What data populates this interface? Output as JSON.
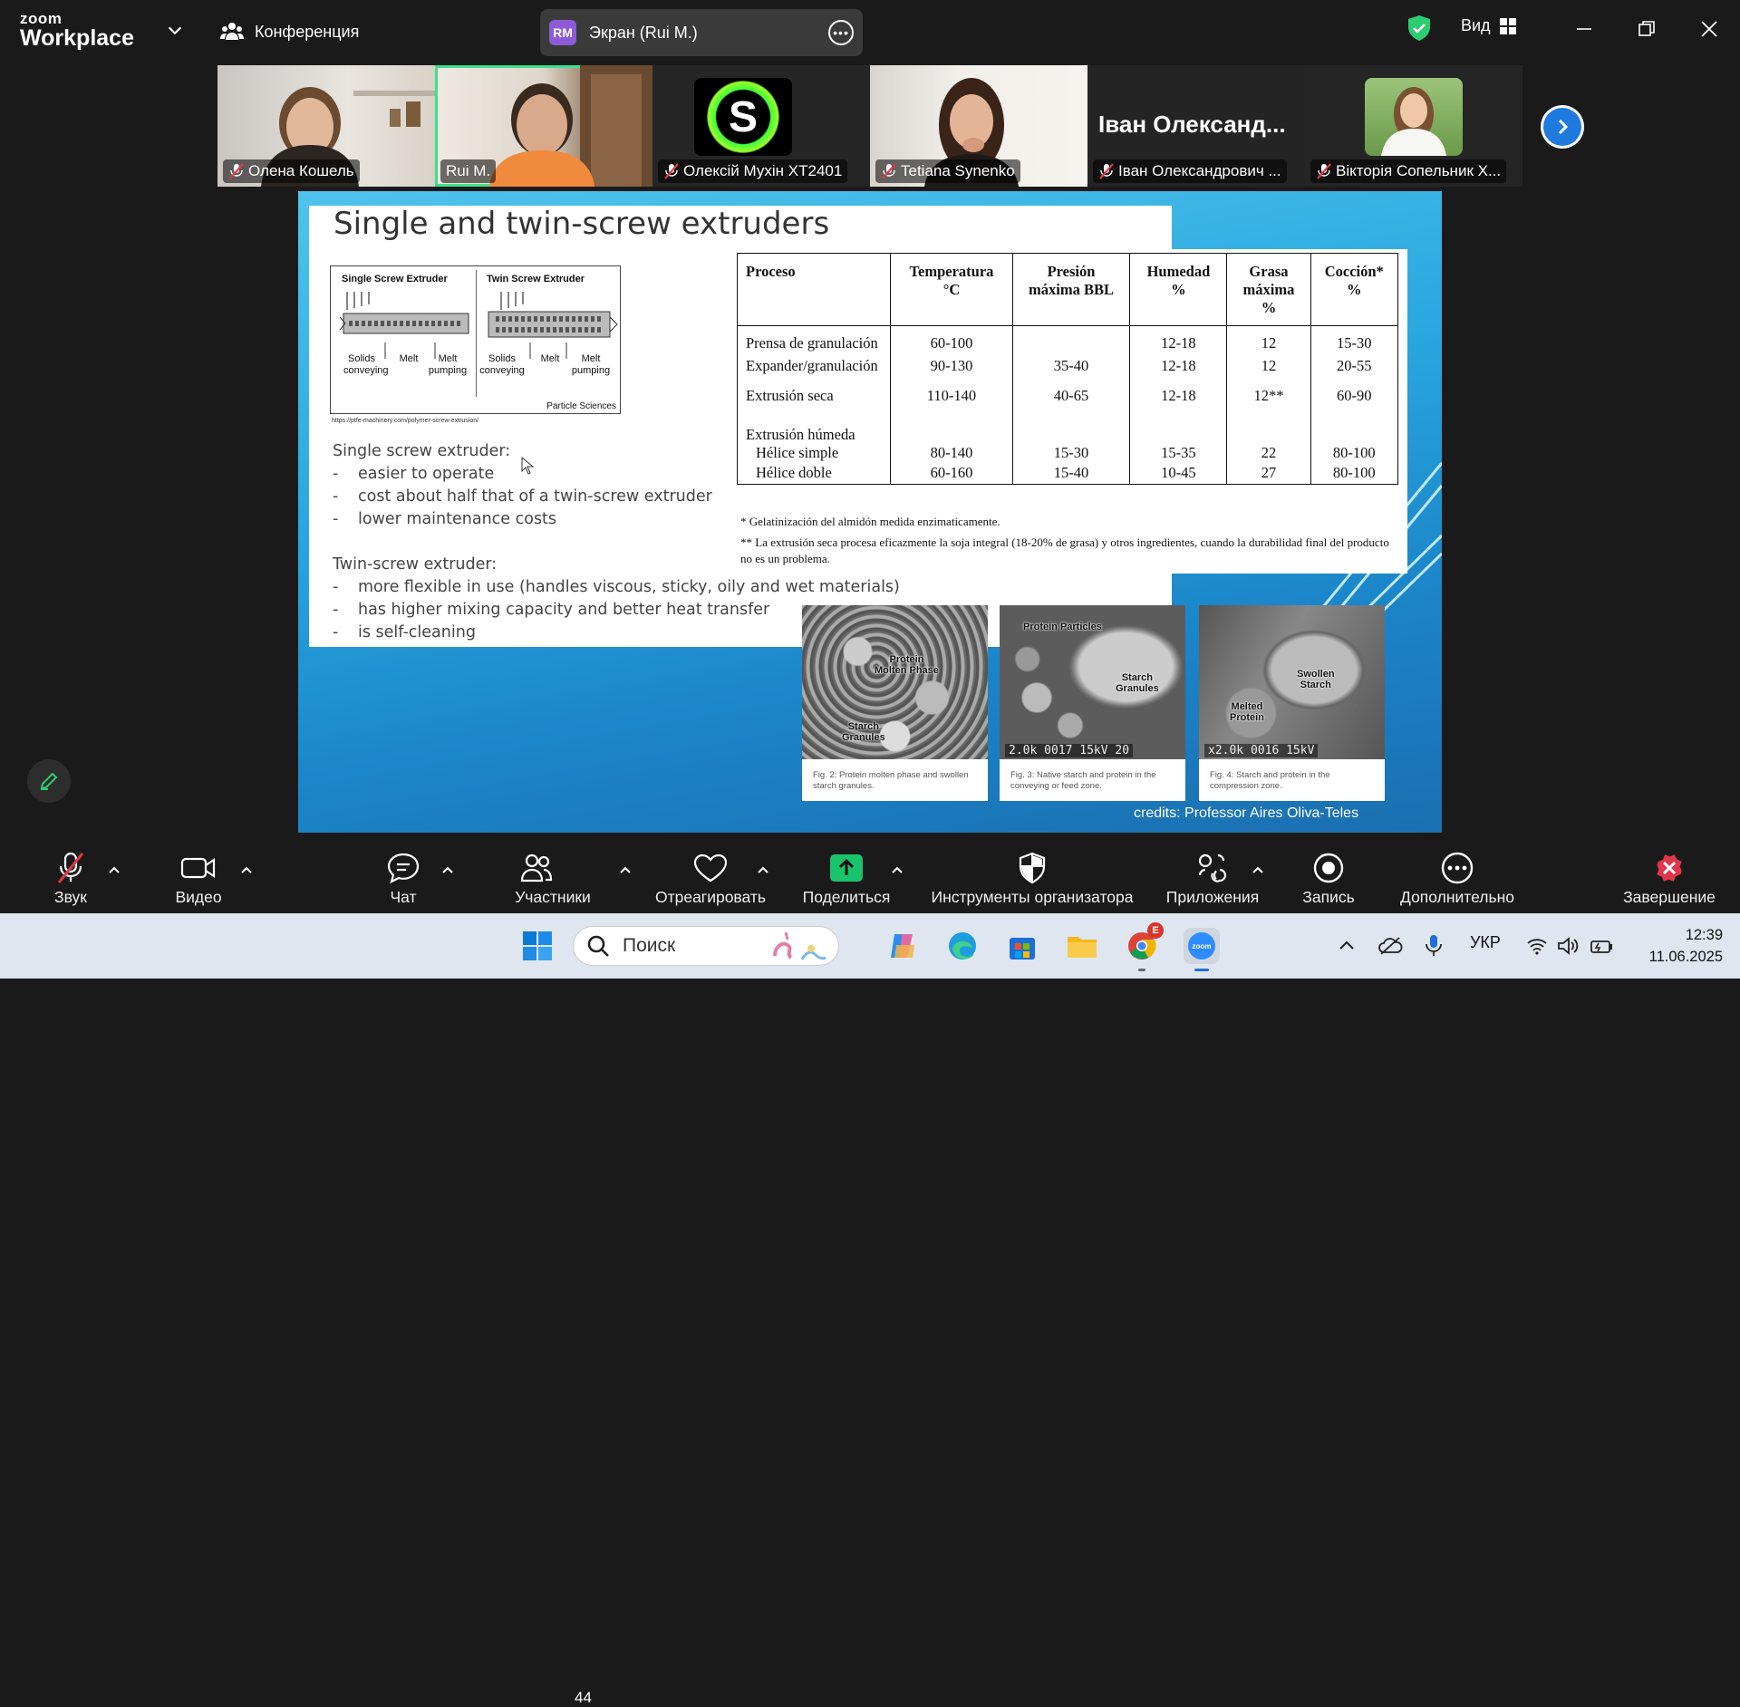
{
  "app": {
    "logo_top": "zoom",
    "logo_bottom": "Workplace"
  },
  "header": {
    "meeting_title": "Конференция",
    "screen_share": {
      "badge": "RM",
      "label": "Экран (Rui M.)"
    },
    "view_label": "Вид",
    "shield_color": "#2ecc71"
  },
  "participants": [
    {
      "name": "Олена Кошель",
      "muted": true
    },
    {
      "name": "Rui M.",
      "muted": false,
      "active": true
    },
    {
      "name": "Олексій Мухін ХТ2401",
      "muted": true,
      "avatar_letter": "S"
    },
    {
      "name": "Tetiana Synenko",
      "muted": true
    },
    {
      "name": "Іван Олександрович ...",
      "muted": true,
      "display_text": "Іван  Олександ..."
    },
    {
      "name": "Вікторія Сопельник Х...",
      "muted": true
    }
  ],
  "slide": {
    "title": "Single and twin-screw extruders",
    "extruder_figure": {
      "single_title": "Single Screw Extruder",
      "twin_title": "Twin Screw Extruder",
      "single_labels": [
        "Solids\nconveying",
        "Melt",
        "Melt\npumping"
      ],
      "twin_labels": [
        "Solids\nconveying",
        "Melt",
        "Melt\npumping"
      ],
      "footer": "Particle Sciences",
      "url": "https://ptfe-machinery.com/polymer-screw-extrusion/"
    },
    "single_heading": "Single screw extruder:",
    "single_points": [
      "easier to operate",
      "cost about half that of a twin-screw extruder",
      "lower maintenance costs"
    ],
    "twin_heading": "Twin-screw extruder:",
    "twin_points": [
      "more flexible in use (handles viscous, sticky, oily and wet materials)",
      "has higher mixing capacity and better heat transfer",
      "is self-cleaning"
    ],
    "table": {
      "headers": [
        "Proceso",
        "Temperatura\n°C",
        "Presión\nmáxima BBL",
        "Humedad\n%",
        "Grasa\nmáxima\n%",
        "Cocción*\n%"
      ],
      "rows": [
        [
          "Prensa de granulación",
          "60-100",
          "",
          "12-18",
          "12",
          "15-30"
        ],
        [
          "Expander/granulación",
          "90-130",
          "35-40",
          "12-18",
          "12",
          "20-55"
        ],
        [
          "Extrusión seca",
          "110-140",
          "40-65",
          "12-18",
          "12**",
          "60-90"
        ],
        [
          "Extrusión húmeda",
          "",
          "",
          "",
          "",
          ""
        ],
        [
          "   Hélice simple",
          "80-140",
          "15-30",
          "15-35",
          "22",
          "80-100"
        ],
        [
          "   Hélice doble",
          "60-160",
          "15-40",
          "10-45",
          "27",
          "80-100"
        ]
      ]
    },
    "note1": "* Gelatinización del almidón medida enzimaticamente.",
    "note2": "** La extrusión seca procesa eficazmente la soja integral (18-20% de grasa) y otros ingredientes, cuando la durabilidad final del producto no es un problema.",
    "sem_images": [
      {
        "tags": [
          "Protein\nMolten Phase",
          "Starch\nGranules"
        ],
        "scale": "",
        "caption": "Fig. 2: Protein molten phase and swollen starch granules."
      },
      {
        "tags": [
          "Protein Particles",
          "Starch\nGranules"
        ],
        "scale": "2.0k 0017  15kV  20",
        "caption": "Fig. 3: Native starch and protein in the conveying or feed zone."
      },
      {
        "tags": [
          "Swollen\nStarch",
          "Melted\nProtein"
        ],
        "scale": "x2.0k 0016  15kV",
        "caption": "Fig. 4: Starch and protein in the compression zone."
      }
    ],
    "credits": "credits: Professor Aires Oliva-Teles"
  },
  "toolbar": {
    "audio": "Звук",
    "video": "Видео",
    "chat": "Чат",
    "participants": "Участники",
    "participants_count": "44",
    "react": "Отреагировать",
    "share": "Поделиться",
    "host_tools": "Инструменты организатора",
    "apps": "Приложения",
    "record": "Запись",
    "more": "Дополнительно",
    "end": "Завершение",
    "share_color": "#19c46a",
    "end_color": "#e0364b"
  },
  "taskbar": {
    "search_placeholder": "Поиск",
    "language": "УКР",
    "time": "12:39",
    "date": "11.06.2025",
    "chrome_badge": "E"
  }
}
